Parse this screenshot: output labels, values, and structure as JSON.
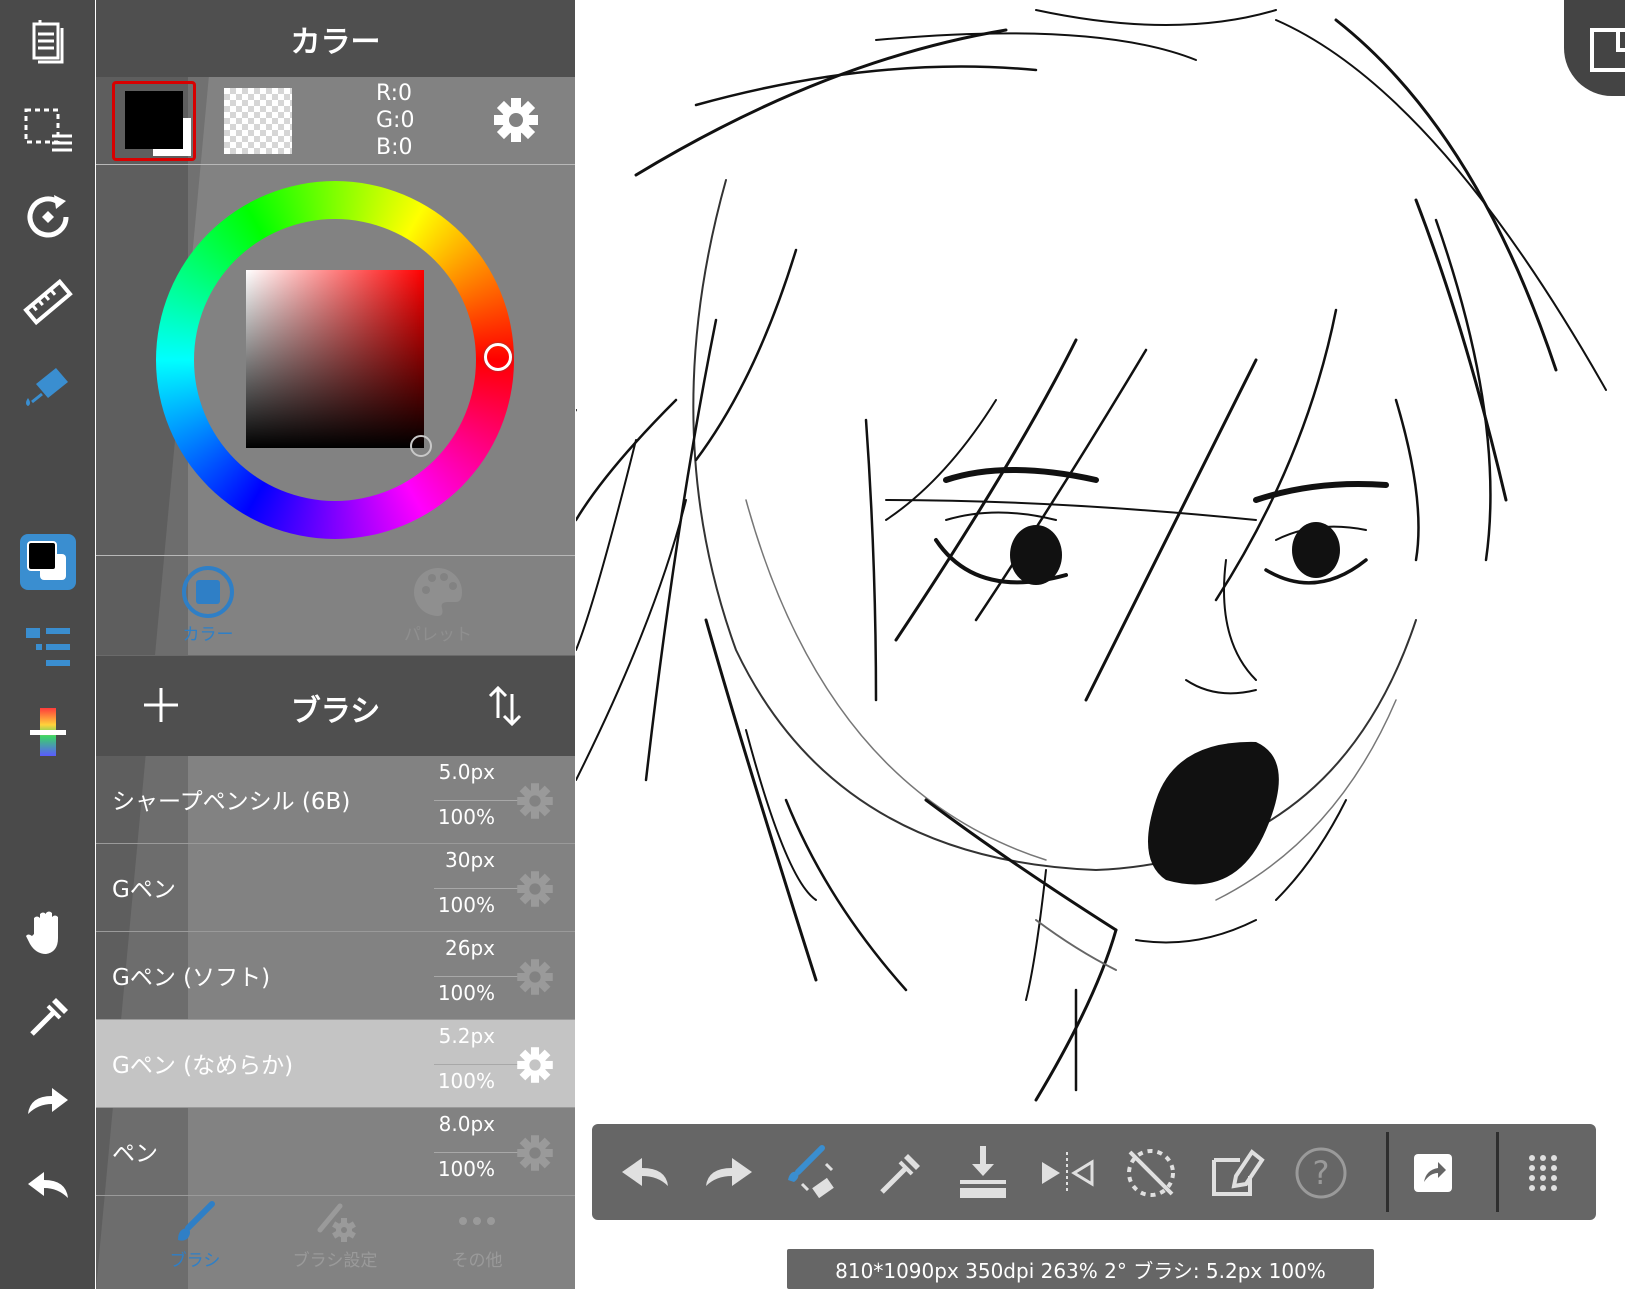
{
  "left_toolbar": {
    "tools": [
      {
        "name": "layers-menu-icon"
      },
      {
        "name": "selection-menu-icon"
      },
      {
        "name": "transform-icon"
      },
      {
        "name": "ruler-icon"
      },
      {
        "name": "fill-bucket-icon"
      },
      {
        "name": "color-swatch-icon"
      },
      {
        "name": "layer-list-icon"
      },
      {
        "name": "color-adjust-icon"
      },
      {
        "name": "hand-icon"
      },
      {
        "name": "eyedropper-icon"
      },
      {
        "name": "redo-icon"
      },
      {
        "name": "undo-icon"
      }
    ],
    "active_color": "#3a8ed0"
  },
  "color_panel": {
    "title": "カラー",
    "foreground": "#000000",
    "background": "#ffffff",
    "rgb": {
      "r": "R:0",
      "g": "G:0",
      "b": "B:0"
    },
    "hue": "#ff0000",
    "tabs": [
      {
        "label": "カラー",
        "active": true
      },
      {
        "label": "パレット",
        "active": false
      }
    ]
  },
  "brush_panel": {
    "title": "ブラシ",
    "brushes": [
      {
        "name": "シャープペンシル (6B)",
        "size": "5.0px",
        "opacity": "100%",
        "selected": false
      },
      {
        "name": "Gペン",
        "size": "30px",
        "opacity": "100%",
        "selected": false
      },
      {
        "name": "Gペン (ソフト)",
        "size": "26px",
        "opacity": "100%",
        "selected": false
      },
      {
        "name": "Gペン (なめらか)",
        "size": "5.2px",
        "opacity": "100%",
        "selected": true
      },
      {
        "name": "ペン",
        "size": "8.0px",
        "opacity": "100%",
        "selected": false
      }
    ],
    "tabs": [
      {
        "label": "ブラシ",
        "active": true
      },
      {
        "label": "ブラシ設定",
        "active": false
      },
      {
        "label": "その他",
        "active": false
      }
    ]
  },
  "bottom_toolbar": {
    "tools": [
      "undo-icon",
      "redo-icon",
      "brush-eraser-switch-icon",
      "eyedropper-icon",
      "layer-merge-down-icon",
      "flip-horizontal-icon",
      "snap-off-icon",
      "text-edit-icon",
      "help-icon",
      "export-icon",
      "menu-grid-icon"
    ]
  },
  "status": {
    "text": "810*1090px 350dpi 263% 2° ブラシ: 5.2px 100%"
  },
  "colors": {
    "panel_bg": "#828282",
    "header_bg": "#4f4f4f",
    "accent": "#2f7fc6",
    "selection_border": "#d80000"
  }
}
